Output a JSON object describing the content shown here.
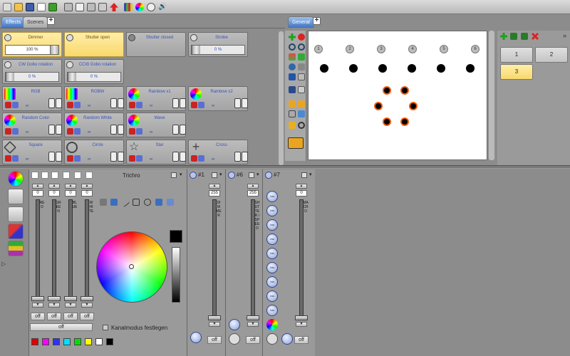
{
  "tabs_left": [
    {
      "label": "Effects"
    },
    {
      "label": "Scenes"
    }
  ],
  "tab_right": {
    "label": "General"
  },
  "effects": [
    {
      "label": "Dimmer",
      "value": "100 %",
      "fill": 1.0
    },
    {
      "label": "Shutter open"
    },
    {
      "label": "Shutter closed"
    },
    {
      "label": "Strobe",
      "value": "0 %",
      "fill": 0.0
    },
    {
      "label": "CW Gobo rotation",
      "value": "0 %",
      "fill": 0.0
    },
    {
      "label": "CCW Gobo rotation",
      "value": "0 %",
      "fill": 0.0
    },
    {
      "label": "RGB",
      "loop": "∞"
    },
    {
      "label": "RGBW",
      "loop": "∞"
    },
    {
      "label": "Rainbow x1",
      "loop": "∞"
    },
    {
      "label": "Rainbow x2",
      "loop": "∞"
    },
    {
      "label": "Random Color",
      "loop": "∞"
    },
    {
      "label": "Random White",
      "loop": "∞"
    },
    {
      "label": "Wave",
      "loop": "∞"
    },
    {
      "label": "Square",
      "loop": "∞"
    },
    {
      "label": "Circle",
      "loop": "∞"
    },
    {
      "label": "Star",
      "loop": "∞"
    },
    {
      "label": "Cross",
      "loop": "∞"
    }
  ],
  "stage_numbers": [
    "1",
    "2",
    "3",
    "4",
    "5",
    "6"
  ],
  "groups": [
    {
      "label": "1"
    },
    {
      "label": "2"
    },
    {
      "label": "3"
    }
  ],
  "fixture_title": "Trichro",
  "trichro_channels": [
    {
      "label": "RED",
      "value": "0",
      "off": "off"
    },
    {
      "label": "GREEN",
      "value": "0",
      "off": "off"
    },
    {
      "label": "BLUE",
      "value": "0",
      "off": "off"
    },
    {
      "label": "WHITE",
      "value": "0",
      "off": "off"
    }
  ],
  "trichro_off": "off",
  "kanalmodus": "Kanalmodus festlegen",
  "fixtures": [
    {
      "title": "#1",
      "top": "255",
      "label": "DIMMER",
      "off": "off"
    },
    {
      "title": "#6",
      "top": "255",
      "label": "SHUTTER / SPEED",
      "off": "off"
    },
    {
      "title": "#7",
      "top": "0",
      "label": "MACRO",
      "off": "off"
    }
  ],
  "macro_buttons": [
    "Ma",
    "Ma",
    "Ma",
    "Ma",
    "Ma",
    "Ma",
    "Ma",
    "Ma",
    "Ma",
    "Ma"
  ],
  "palette": [
    "#e00000",
    "#ff00ff",
    "#3030ff",
    "#00e0ff",
    "#00e000",
    "#ffff00",
    "#ffffff",
    "#000000"
  ]
}
